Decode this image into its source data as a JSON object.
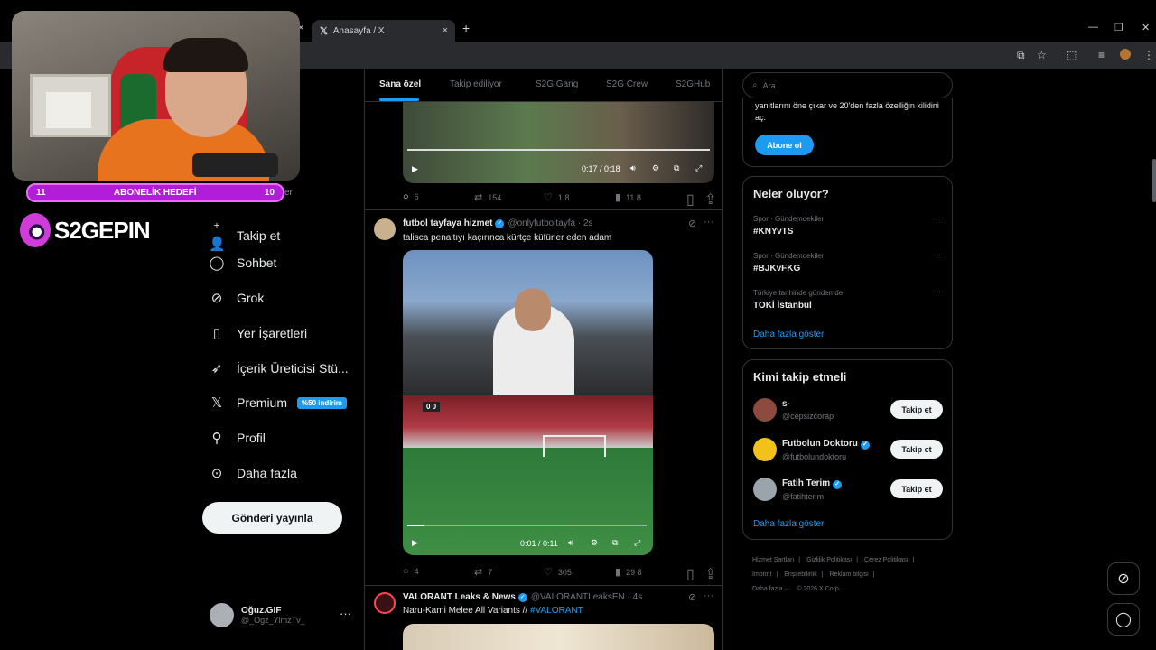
{
  "browser": {
    "tab_title": "Anasayfa / X",
    "tab_close": "×",
    "new_tab": "+",
    "win_min": "—",
    "win_max": "❐",
    "win_close": "✕"
  },
  "stream": {
    "goal_left": "11",
    "goal_label": "ABONELİK HEDEFİ",
    "goal_right": "10",
    "goal_after": "er",
    "logo_text": "S2GEPIN"
  },
  "nav": {
    "items": [
      {
        "label": "Takip et",
        "icon": "add-user-icon"
      },
      {
        "label": "Sohbet",
        "icon": "chat-icon"
      },
      {
        "label": "Grok",
        "icon": "grok-icon"
      },
      {
        "label": "Yer İşaretleri",
        "icon": "bookmark-icon"
      },
      {
        "label": "İçerik Üreticisi Stü...",
        "icon": "rocket-icon"
      },
      {
        "label": "Premium",
        "icon": "x-logo-icon"
      },
      {
        "label": "Profil",
        "icon": "person-icon"
      },
      {
        "label": "Daha fazla",
        "icon": "more-circle-icon"
      }
    ],
    "premium_badge": "%50 indirim",
    "post_button": "Gönderi yayınla",
    "user_name": "Oğuz.GIF",
    "user_handle": "@_Ogz_YlmzTv_",
    "user_more": "···"
  },
  "feed": {
    "tabs": [
      "Sana özel",
      "Takip ediliyor",
      "S2G Gang",
      "S2G Crew",
      "S2GHub"
    ],
    "post0": {
      "time": "0:17 / 0:18",
      "replies": "6",
      "reposts": "154",
      "likes": "1 8",
      "views": "11 8"
    },
    "post1": {
      "name": "futbol tayfaya hizmet",
      "handle": "@onlyfutboltayfa · 2s",
      "text": "talisca penaltıyı kaçırınca kürtçe küfürler eden adam",
      "time": "0:01 / 0:11",
      "score": "0  0",
      "replies": "4",
      "reposts": "7",
      "likes": "305",
      "views": "29 8"
    },
    "post2": {
      "name": "VALORANT Leaks & News",
      "handle": "@VALORANTLeaksEN · 4s",
      "text": "Naru-Kami Melee All Variants // ",
      "hashtag": "#VALORANT"
    }
  },
  "right": {
    "search_placeholder": "Ara",
    "subscribe_text": "yanıtlarını öne çıkar ve 20'den fazla özelliğin kilidini aç.",
    "subscribe_button": "Abone ol",
    "trends_title": "Neler oluyor?",
    "trends": [
      {
        "category": "Spor · Gündemdekiler",
        "title": "#KNYvTS"
      },
      {
        "category": "Spor · Gündemdekiler",
        "title": "#BJKvFKG"
      },
      {
        "category": "Türkiye tarihinde gündemde",
        "title": "TOKİ İstanbul"
      }
    ],
    "show_more": "Daha fazla göster",
    "who_title": "Kimi takip etmeli",
    "who": [
      {
        "name": "s-",
        "handle": "@cepsizcorap",
        "verified": false
      },
      {
        "name": "Futbolun Doktoru",
        "handle": "@futbolundoktoru",
        "verified": true
      },
      {
        "name": "Fatih Terim",
        "handle": "@fatihterim",
        "verified": true
      }
    ],
    "follow_button": "Takip et",
    "footer": [
      "Hizmet Şartları",
      "|",
      "Gizlilik Politikası",
      "|",
      "Çerez Politikası",
      "|",
      "Imprint",
      "|",
      "Erişilebilirlik",
      "|",
      "Reklam bilgisi",
      "|",
      "Daha fazla ···",
      "© 2026 X Corp."
    ]
  },
  "colors": {
    "accent": "#1d9bf0",
    "border": "#2f3336",
    "muted": "#71767b",
    "goal": "#b21dd9"
  }
}
